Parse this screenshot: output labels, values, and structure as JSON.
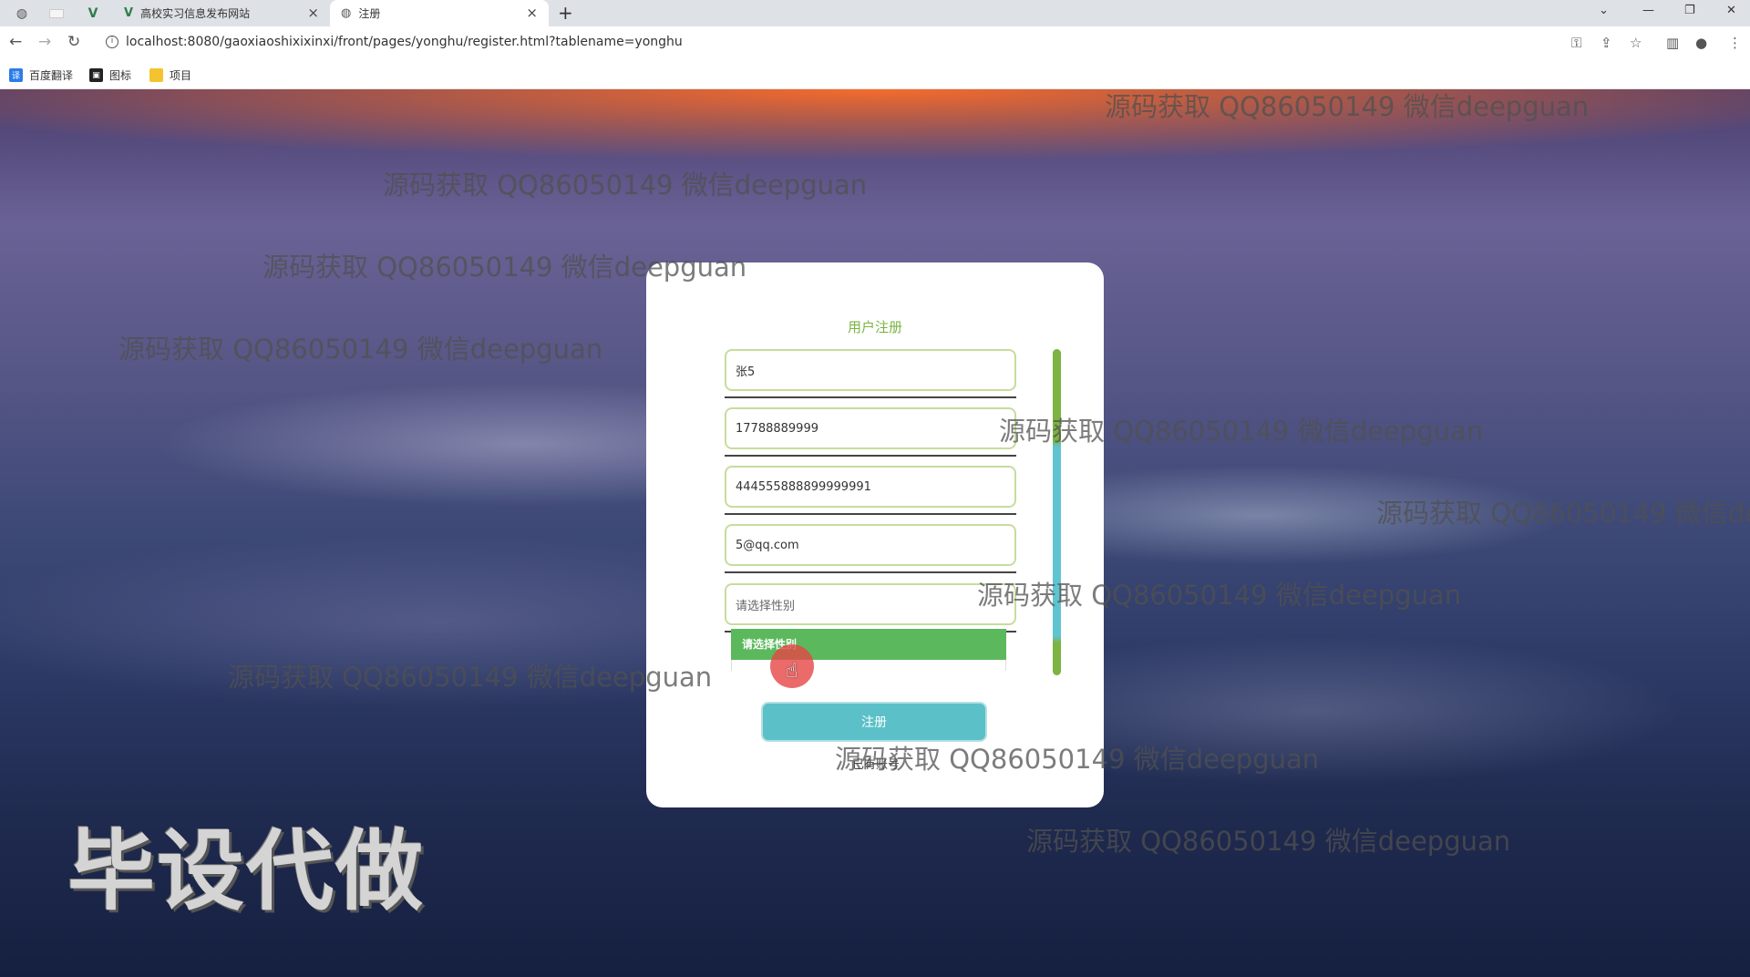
{
  "browser": {
    "tabs": [
      {
        "title": "高校实习信息发布网站",
        "active": false
      },
      {
        "title": "注册",
        "active": true
      }
    ],
    "new_tab": "+",
    "url": "localhost:8080/gaoxiaoshixixinxi/front/pages/yonghu/register.html?tablename=yonghu",
    "bookmarks": [
      {
        "label": "百度翻译",
        "icon": "translate-icon",
        "color": "#2b7de9"
      },
      {
        "label": "图标",
        "icon": "image-icon",
        "color": "#222222"
      },
      {
        "label": "项目",
        "icon": "folder-icon",
        "color": "#f4c430"
      }
    ]
  },
  "register": {
    "title": "用户注册",
    "fields": [
      {
        "name": "username",
        "value": "张5"
      },
      {
        "name": "phone",
        "value": "17788889999"
      },
      {
        "name": "id_card",
        "value": "444555888899999991"
      },
      {
        "name": "email",
        "value": "5@qq.com"
      }
    ],
    "gender_select": {
      "placeholder": "请选择性别",
      "dropdown_option": "请选择性别"
    },
    "submit_label": "注册",
    "login_link": "已有账号"
  },
  "watermarks": {
    "text": "源码获取 QQ86050149 微信deepguan",
    "big_text": "毕设代做"
  },
  "colors": {
    "accent_green": "#7cb342",
    "button_teal": "#5bc0c8",
    "dropdown_green": "#5cb85c"
  }
}
